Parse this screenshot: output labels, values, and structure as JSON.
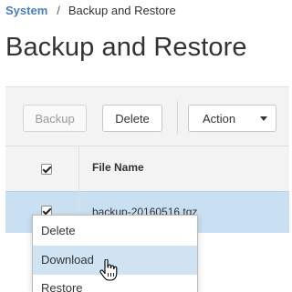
{
  "breadcrumb": {
    "root": "System",
    "separator": "/",
    "current": "Backup and Restore"
  },
  "page": {
    "title": "Backup and Restore"
  },
  "toolbar": {
    "backup_label": "Backup",
    "delete_label": "Delete",
    "action_label": "Action"
  },
  "table": {
    "header": {
      "select_all_checked": true,
      "file_name_label": "File Name"
    },
    "rows": [
      {
        "checked": true,
        "file_name": "backup-20160516.tgz",
        "selected": true
      }
    ]
  },
  "context_menu": {
    "items": [
      {
        "label": "Delete"
      },
      {
        "label": "Download"
      },
      {
        "label": "Restore"
      }
    ],
    "hovered_item": "Download"
  },
  "colors": {
    "link": "#4a7fb5",
    "selected_row": "#c9e0f2",
    "menu_hover": "#cfe3f3",
    "panel_bg": "#f3f3f3"
  },
  "icons": {
    "checkbox": "checkbox-checked-icon",
    "dropdown": "caret-down-icon",
    "cursor": "hand-pointer-icon"
  }
}
